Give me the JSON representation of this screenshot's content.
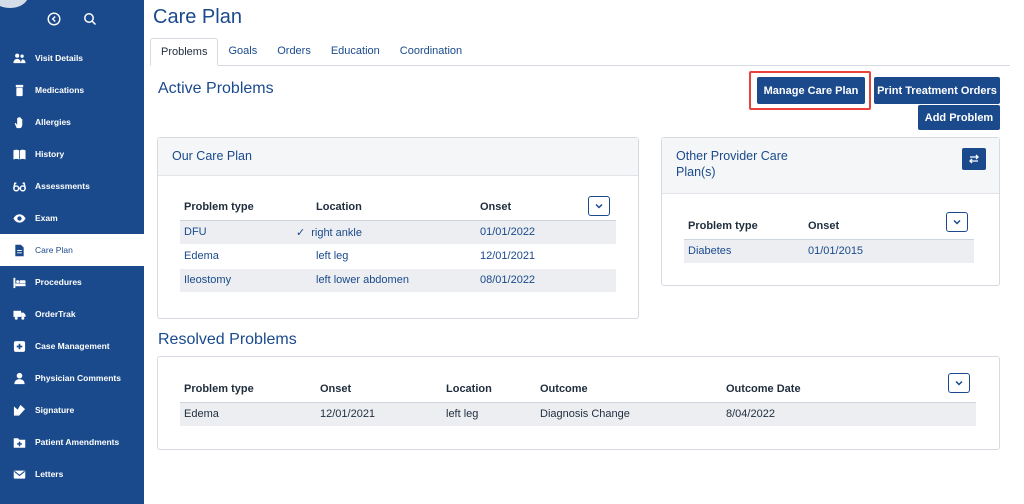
{
  "sidebar": {
    "items": [
      {
        "label": "Visit Details",
        "icon": "users-icon"
      },
      {
        "label": "Medications",
        "icon": "pill-bottle-icon"
      },
      {
        "label": "Allergies",
        "icon": "hand-icon"
      },
      {
        "label": "History",
        "icon": "book-icon"
      },
      {
        "label": "Assessments",
        "icon": "glasses-icon"
      },
      {
        "label": "Exam",
        "icon": "eye-icon"
      },
      {
        "label": "Care Plan",
        "icon": "document-icon"
      },
      {
        "label": "Procedures",
        "icon": "procedures-icon"
      },
      {
        "label": "OrderTrak",
        "icon": "truck-icon"
      },
      {
        "label": "Case Management",
        "icon": "medical-case-icon"
      },
      {
        "label": "Physician Comments",
        "icon": "user-icon"
      },
      {
        "label": "Signature",
        "icon": "signature-icon"
      },
      {
        "label": "Patient Amendments",
        "icon": "folder-plus-icon"
      },
      {
        "label": "Letters",
        "icon": "envelope-icon"
      }
    ]
  },
  "page": {
    "title": "Care Plan"
  },
  "tabs": [
    "Problems",
    "Goals",
    "Orders",
    "Education",
    "Coordination"
  ],
  "active": {
    "title": "Active Problems",
    "buttons": {
      "manage": "Manage Care Plan",
      "print": "Print Treatment Orders",
      "add": "Add Problem"
    }
  },
  "our_care_plan": {
    "title": "Our Care Plan",
    "headers": [
      "Problem type",
      "Location",
      "Onset"
    ],
    "rows": [
      {
        "type": "DFU",
        "location": "right ankle",
        "onset": "01/01/2022",
        "checked": true
      },
      {
        "type": "Edema",
        "location": "left leg",
        "onset": "12/01/2021",
        "checked": false
      },
      {
        "type": "Ileostomy",
        "location": "left lower abdomen",
        "onset": "08/01/2022",
        "checked": false
      }
    ]
  },
  "other_provider": {
    "title": "Other Provider Care Plan(s)",
    "headers": [
      "Problem type",
      "Onset"
    ],
    "rows": [
      {
        "type": "Diabetes",
        "onset": "01/01/2015"
      }
    ]
  },
  "resolved": {
    "title": "Resolved Problems",
    "headers": [
      "Problem type",
      "Onset",
      "Location",
      "Outcome",
      "Outcome Date"
    ],
    "rows": [
      {
        "type": "Edema",
        "onset": "12/01/2021",
        "location": "left leg",
        "outcome": "Diagnosis Change",
        "outcome_date": "8/04/2022"
      }
    ]
  },
  "colors": {
    "brand": "#1a4a8c",
    "highlight": "#e8423a",
    "row_shade": "#eceef1"
  }
}
